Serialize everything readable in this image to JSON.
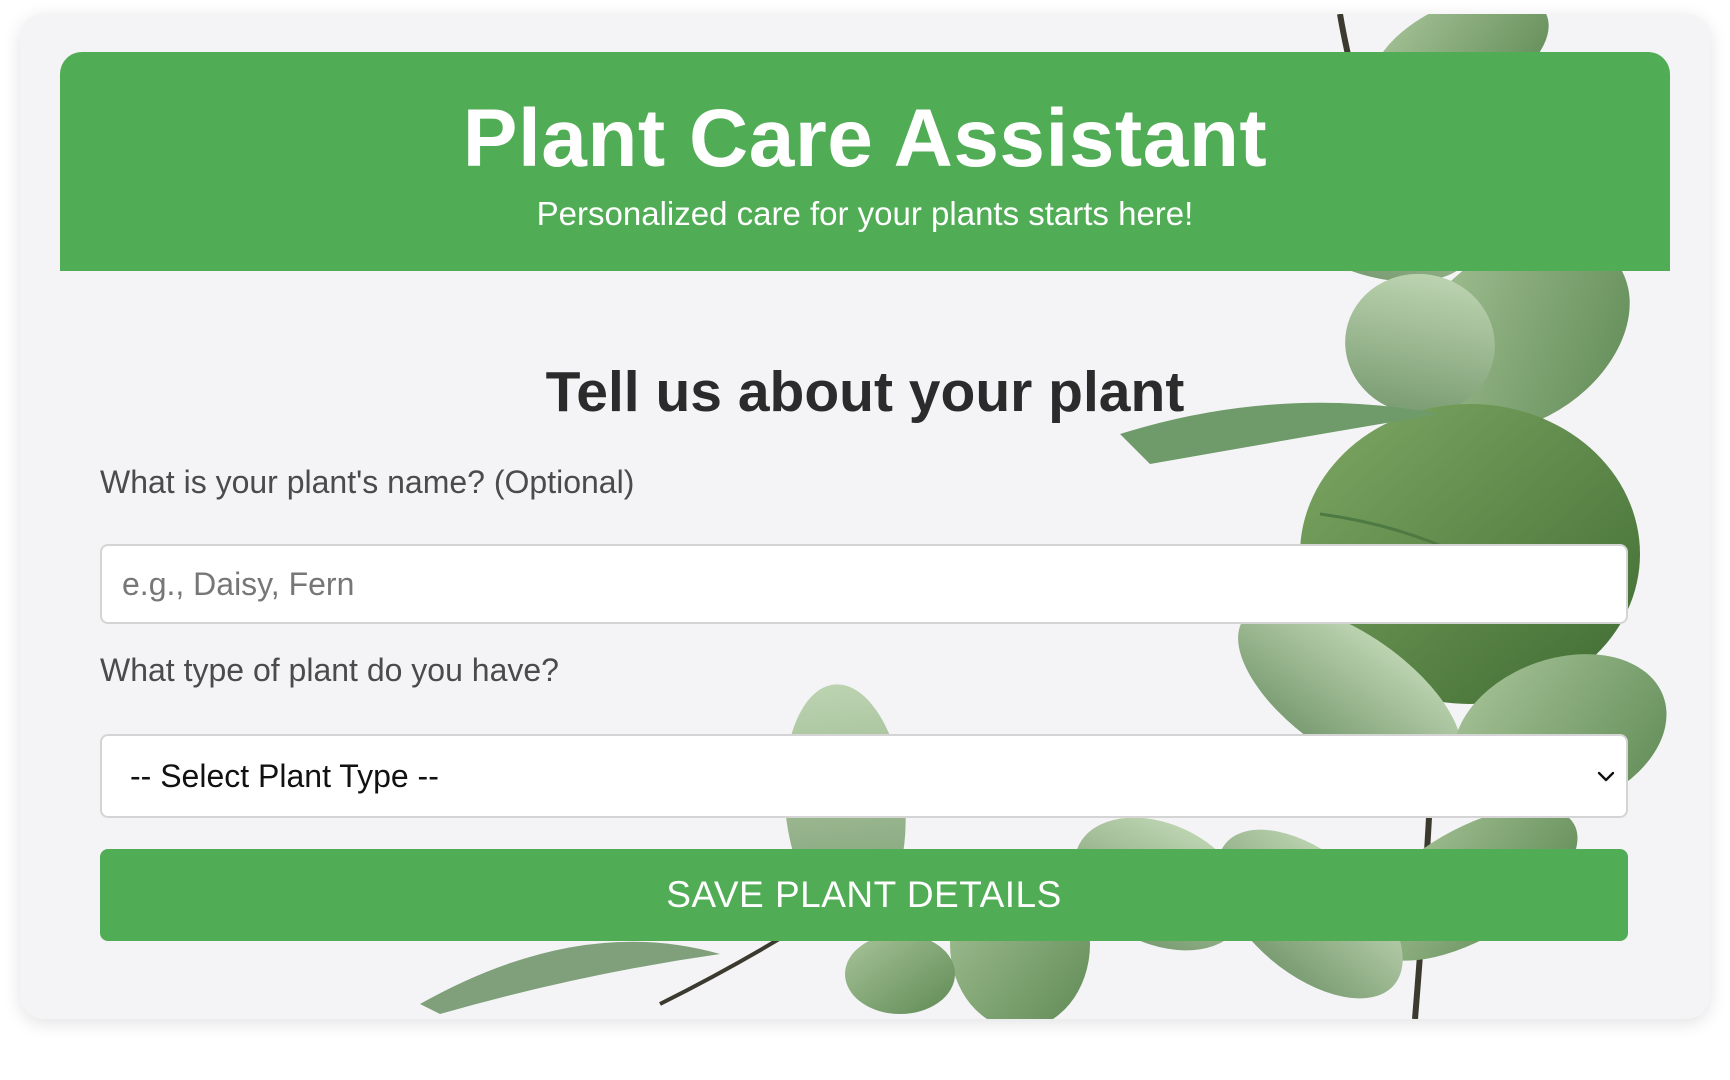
{
  "header": {
    "title": "Plant Care Assistant",
    "subtitle": "Personalized care for your plants starts here!"
  },
  "form": {
    "title": "Tell us about your plant",
    "name_label": "What is your plant's name? (Optional)",
    "name_placeholder": "e.g., Daisy, Fern",
    "name_value": "",
    "type_label": "What type of plant do you have?",
    "type_selected": "-- Select Plant Type --",
    "save_label": "SAVE PLANT DETAILS"
  },
  "icons": {
    "select_chevron": "chevron-down-icon",
    "background": "eucalyptus-leaves"
  },
  "colors": {
    "accent": "#51ad55",
    "card_bg": "#f4f4f6",
    "heading": "#2b2b2b",
    "label": "#4b4b4b"
  }
}
